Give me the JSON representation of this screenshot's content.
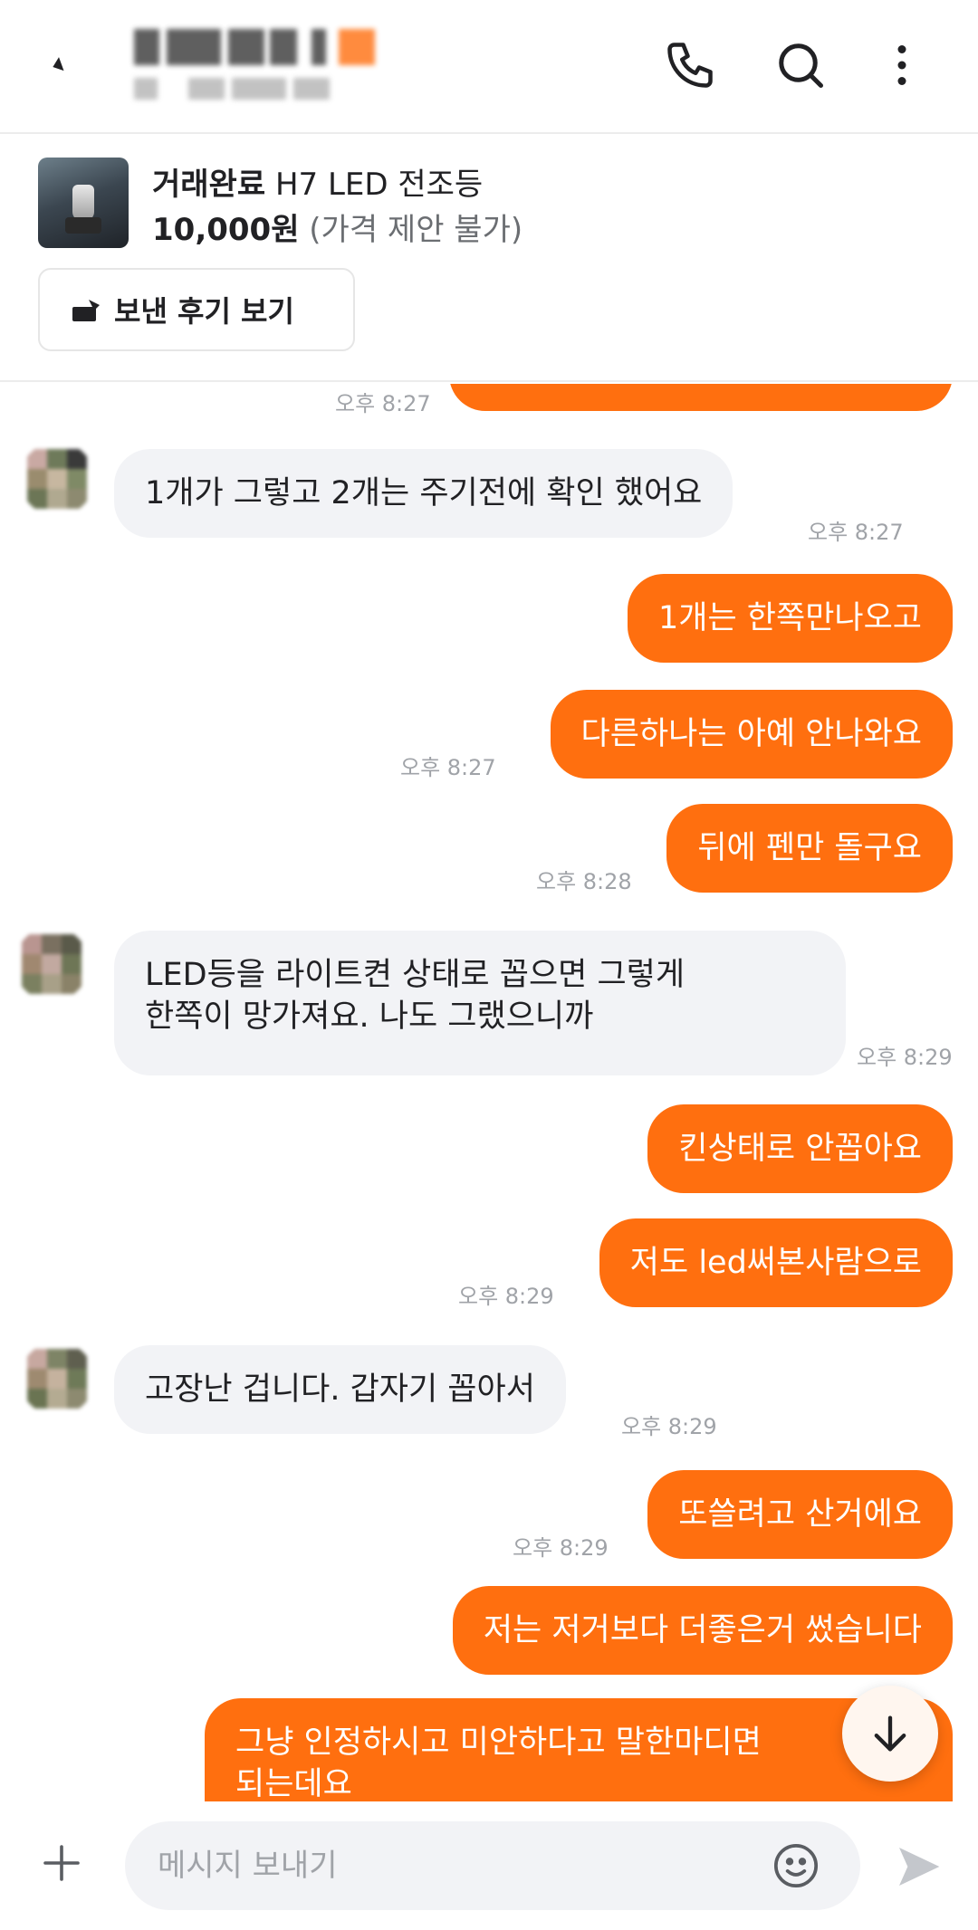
{
  "header": {
    "back_icon": "back-arrow-icon",
    "call_icon": "phone-icon",
    "search_icon": "search-icon",
    "more_icon": "more-vertical-icon",
    "accent": "#ff6f0f"
  },
  "product": {
    "status": "거래완료",
    "name": "H7 LED 전조등",
    "price": "10,000원",
    "price_note": "(가격 제안 불가)",
    "review_button": "보낸 후기 보기"
  },
  "messages": [
    {
      "from": "me",
      "text": "",
      "time": "오후 8:27"
    },
    {
      "from": "them",
      "text": "1개가 그렇고 2개는 주기전에 확인 했어요",
      "time": "오후 8:27"
    },
    {
      "from": "me",
      "text": "1개는 한쪽만나오고",
      "time": ""
    },
    {
      "from": "me",
      "text": "다른하나는 아예 안나와요",
      "time": "오후 8:27"
    },
    {
      "from": "me",
      "text": "뒤에 펜만 돌구요",
      "time": "오후 8:28"
    },
    {
      "from": "them",
      "text1": "LED등을 라이트켠 상태로 꼽으면 그렇게",
      "text2": "한쪽이 망가져요. 나도 그랬으니까",
      "time": "오후 8:29"
    },
    {
      "from": "me",
      "text": "킨상태로 안꼽아요",
      "time": ""
    },
    {
      "from": "me",
      "text": "저도 led써본사람으로",
      "time": "오후 8:29"
    },
    {
      "from": "them",
      "text": "고장난 겁니다. 갑자기 꼽아서",
      "time": "오후 8:29"
    },
    {
      "from": "me",
      "text": "또쓸려고 산거에요",
      "time": "오후 8:29"
    },
    {
      "from": "me",
      "text": "저는 저거보다 더좋은거 썼습니다",
      "time": ""
    },
    {
      "from": "me",
      "text1": "그냥 인정하시고 미안하다고 말한마디면",
      "text2": "되는데요",
      "time": ""
    }
  ],
  "composer": {
    "placeholder": "메시지 보내기",
    "plus_icon": "plus-icon",
    "emoji_icon": "emoji-icon",
    "send_icon": "send-icon",
    "scroll_icon": "arrow-down-icon"
  }
}
